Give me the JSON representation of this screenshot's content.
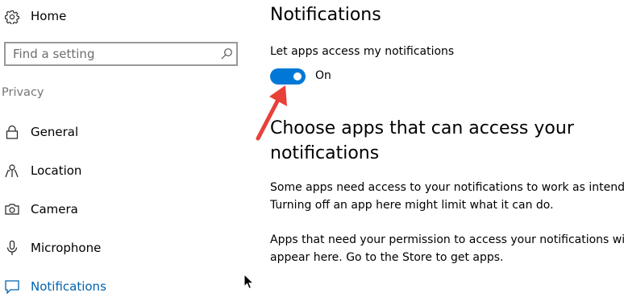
{
  "sidebar": {
    "home_label": "Home",
    "search": {
      "placeholder": "Find a setting",
      "value": ""
    },
    "section_header": "Privacy",
    "items": [
      {
        "label": "General",
        "icon": "lock-icon",
        "active": false
      },
      {
        "label": "Location",
        "icon": "location-icon",
        "active": false
      },
      {
        "label": "Camera",
        "icon": "camera-icon",
        "active": false
      },
      {
        "label": "Microphone",
        "icon": "microphone-icon",
        "active": false
      },
      {
        "label": "Notifications",
        "icon": "notifications-icon",
        "active": true
      }
    ]
  },
  "main": {
    "title": "Notifications",
    "toggle_caption": "Let apps access my notifications",
    "toggle_on": true,
    "toggle_state": "On",
    "heading": "Choose apps that can access your notifications",
    "paragraph_1": {
      "line_1": "Some apps need access to your notifications to work as intended.",
      "line_2": "Turning off an app here might limit what it can do."
    },
    "paragraph_2": {
      "line_1": "Apps that need your permission to access your notifications will",
      "line_2": "appear here. Go to the Store to get apps."
    }
  },
  "colors": {
    "accent": "#0078d7",
    "active_nav_text": "#0063b1",
    "section_header": "#767676",
    "annotation_arrow": "#e8413a"
  }
}
